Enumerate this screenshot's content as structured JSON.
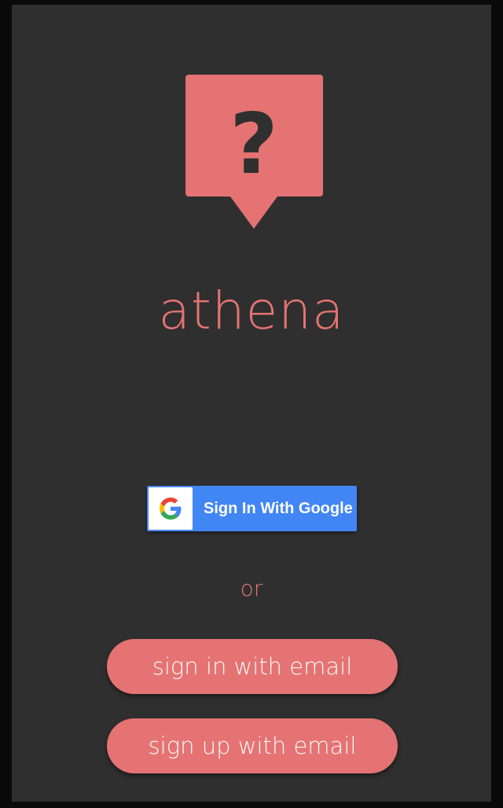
{
  "app": {
    "name": "athena",
    "accent_color": "#e57373",
    "background_color": "#2f2f2f",
    "logo_icon": "question-speech-bubble-icon"
  },
  "auth": {
    "google_button_label": "Sign In With Google",
    "google_icon": "google-g-icon",
    "google_button_color": "#4285f4",
    "separator_text": "or",
    "sign_in_email_label": "sign in with email",
    "sign_up_email_label": "sign up with email"
  }
}
